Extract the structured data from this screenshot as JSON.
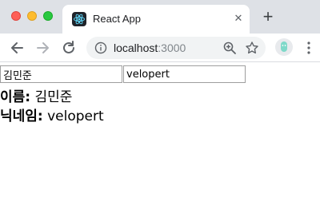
{
  "window": {
    "tab_title": "React App"
  },
  "toolbar": {
    "url_host": "localhost",
    "url_port": ":3000"
  },
  "form": {
    "name_value": "김민준",
    "nickname_value": "velopert"
  },
  "display": {
    "name_label": "이름:",
    "name_value": "김민준",
    "nickname_label": "닉네임:",
    "nickname_value": "velopert"
  }
}
